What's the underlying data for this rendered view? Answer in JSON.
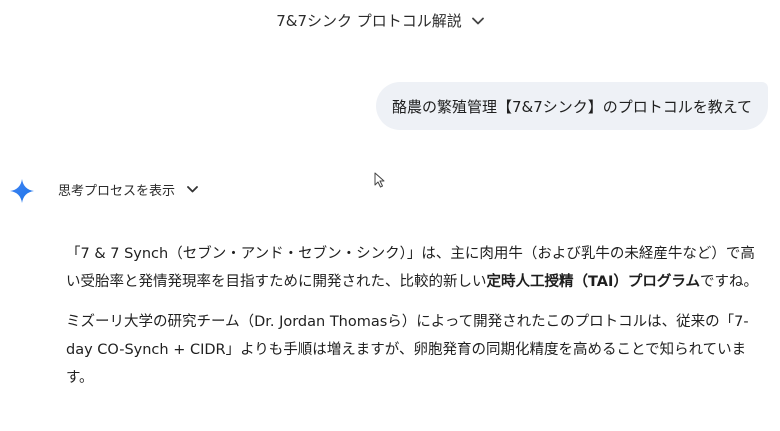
{
  "header": {
    "conversation_title": "7&7シンク プロトコル解説",
    "chevron_icon": "chevron-down-icon"
  },
  "user_message": {
    "text": "酪農の繁殖管理【7&7シンク】のプロトコルを教えて"
  },
  "assistant": {
    "avatar_icon": "gemini-spark-icon",
    "accent_color": "#4285f4",
    "show_thinking_label": "思考プロセスを表示",
    "paragraph1": {
      "part1": "「7 & 7 Synch（セブン・アンド・セブン・シンク）」は、主に肉用牛（および乳牛の未経産牛など）で高い受胎率と発情発現率を目指すために開発された、比較的新しい",
      "bold": "定時人工授精（TAI）プログラム",
      "part2": "ですね。"
    },
    "paragraph2": "ミズーリ大学の研究チーム（Dr. Jordan Thomasら）によって開発されたこのプロトコルは、従来の「7-day CO-Synch + CIDR」よりも手順は増えますが、卵胞発育の同期化精度を高めることで知られています。"
  }
}
